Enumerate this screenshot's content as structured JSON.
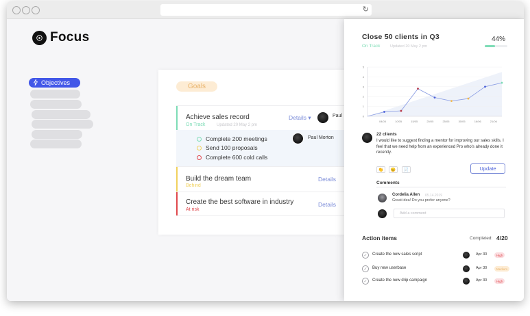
{
  "app": {
    "name": "Focus"
  },
  "nav": {
    "active_label": "Objectives"
  },
  "goals": {
    "pill_label": "Goals",
    "items": [
      {
        "title": "Achieve sales record",
        "status": "On Track",
        "status_color": "#7ddcb6",
        "updated": "Updated 20 May 2 pm",
        "details": "Details",
        "owner": "Paul"
      },
      {
        "title": "Build the dream team",
        "status": "Behind",
        "status_color": "#f1d15c",
        "details": "Details"
      },
      {
        "title": "Create the best software in industry",
        "status": "At risk",
        "status_color": "#e0474c",
        "details": "Details"
      }
    ],
    "subtasks": [
      {
        "label": "Complete 200 meetings",
        "color": "#7ddcb6"
      },
      {
        "label": "Send 100 proposals",
        "color": "#f1d15c"
      },
      {
        "label": "Complete 600 cold calls",
        "color": "#e0474c"
      }
    ],
    "subtask_owner": "Paul Morton"
  },
  "panel": {
    "title": "Close 50 clients in Q3",
    "status": "On Track",
    "updated": "Updated 20 May 2 pm",
    "progress_label": "44%",
    "progress_value": 0.44,
    "comment_count": "22 clients",
    "comment_text": "I would like to suggest finding a mentor for improving our sales skills. I feel that we need help from an experienced Pro who's already done it recently.",
    "update_label": "Update",
    "comments_label": "Comments",
    "comment": {
      "name": "Cordelia Allen",
      "time": "05.14.2019",
      "text": "Great idea! Do you prefer anyone?"
    },
    "add_comment_placeholder": "Add a comment",
    "reactions": [
      "👏",
      "😊",
      "📄"
    ]
  },
  "chart_data": {
    "type": "line",
    "categories": [
      "04/05",
      "10/05",
      "15/05",
      "20/05",
      "25/05",
      "30/05",
      "16/06",
      "21/06"
    ],
    "y_ticks": [
      0,
      1,
      2,
      3,
      4,
      5
    ],
    "ylim": [
      0,
      5
    ],
    "series": [
      {
        "values": [
          0,
          0.45,
          0.55,
          2.8,
          1.9,
          1.55,
          1.8,
          3.0,
          3.4
        ]
      }
    ],
    "point_colors": [
      "#4a5fd8",
      "#4a5fd8",
      "#b83a4b",
      "#b83a4b",
      "#4a5fd8",
      "#f1b84c",
      "#f1b84c",
      "#4a5fd8",
      "#7ddcb6"
    ]
  },
  "actions": {
    "title": "Action items",
    "completed_label": "Completed:",
    "completed_count": "4/20",
    "items": [
      {
        "label": "Create the new sales script",
        "date": "Apr 30",
        "tag": "High",
        "tag_bg": "#fbdde0",
        "tag_color": "#e0474c"
      },
      {
        "label": "Buy new userbase",
        "date": "Apr 30",
        "tag": "Medium",
        "tag_bg": "#fdecd4",
        "tag_color": "#e9b36b"
      },
      {
        "label": "Create the new drip campaign",
        "date": "Apr 30",
        "tag": "High",
        "tag_bg": "#fbdde0",
        "tag_color": "#e0474c"
      }
    ]
  }
}
